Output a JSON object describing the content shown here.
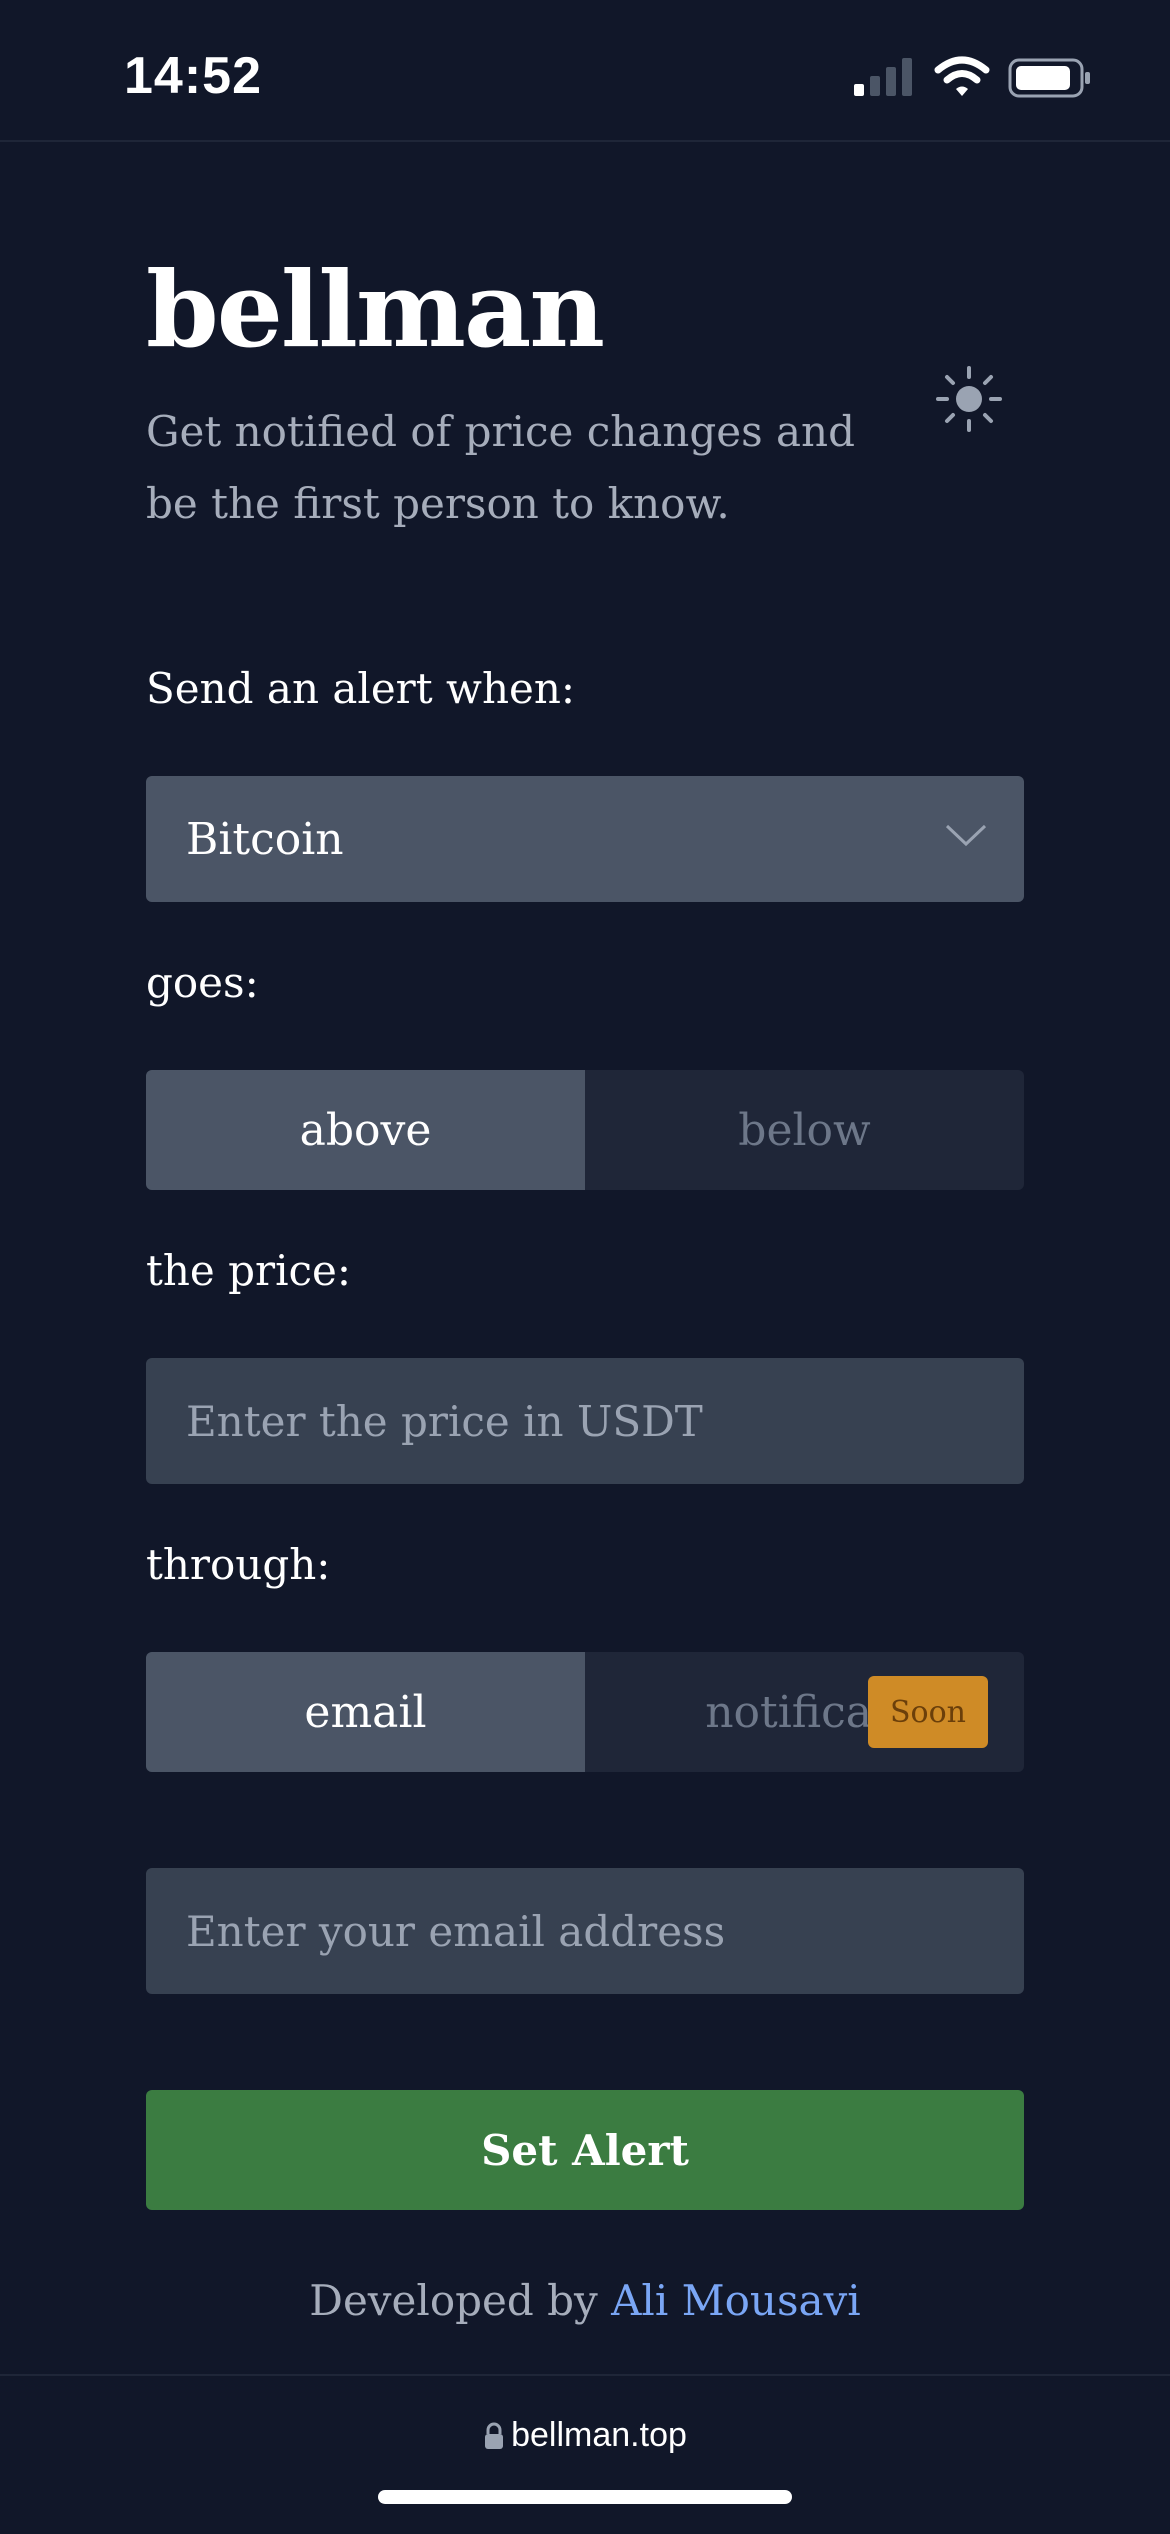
{
  "status_bar": {
    "time": "14:52"
  },
  "header": {
    "brand": "bellman",
    "tagline": "Get notified of price changes and be the first person to know."
  },
  "form": {
    "alert_label": "Send an alert when:",
    "asset_select": {
      "value": "Bitcoin"
    },
    "direction_label": "goes:",
    "direction_options": [
      "above",
      "below"
    ],
    "direction_selected": "above",
    "price_label": "the price:",
    "price_placeholder": "Enter the price in USDT",
    "channel_label": "through:",
    "channel_options": [
      "email",
      "notificati"
    ],
    "channel_selected": "email",
    "soon_badge": "Soon",
    "email_placeholder": "Enter your email address",
    "submit_label": "Set Alert"
  },
  "footer": {
    "credit_prefix": "Developed by",
    "credit_name": "Ali Mousavi"
  },
  "browser": {
    "url": "bellman.top"
  },
  "colors": {
    "background": "#111729",
    "accent_green": "#3b7c41",
    "badge_amber": "#cf8b26",
    "link_blue": "#7aa6f5"
  },
  "icons": [
    "signal-icon",
    "wifi-icon",
    "battery-icon",
    "sun-icon",
    "chevron-down-icon",
    "lock-icon"
  ]
}
